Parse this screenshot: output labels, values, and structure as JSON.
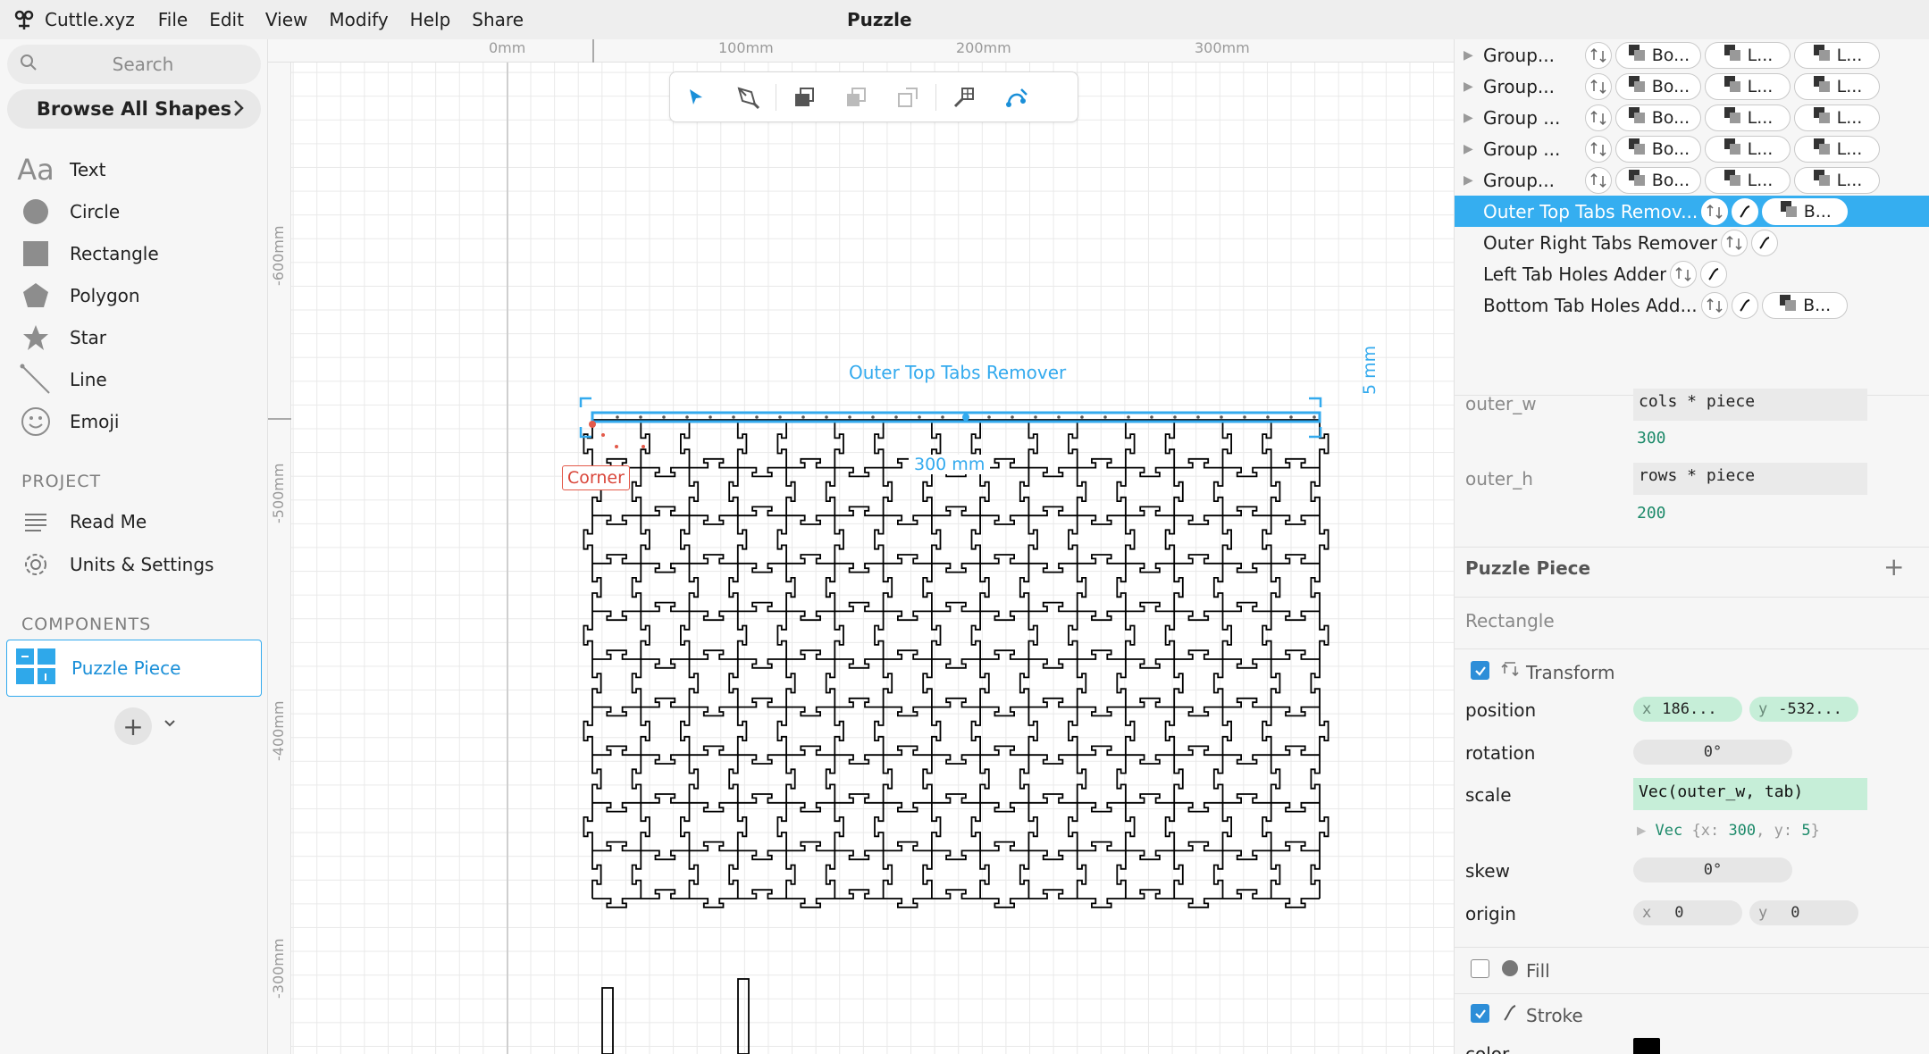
{
  "app": {
    "name": "Cuttle.xyz",
    "menu": [
      "File",
      "Edit",
      "View",
      "Modify",
      "Help",
      "Share"
    ],
    "document_title": "Puzzle"
  },
  "sidebar": {
    "search_placeholder": "Search",
    "browse_label": "Browse All Shapes",
    "shapes": [
      {
        "label": "Text",
        "icon": "text-icon"
      },
      {
        "label": "Circle",
        "icon": "circle-icon"
      },
      {
        "label": "Rectangle",
        "icon": "rectangle-icon"
      },
      {
        "label": "Polygon",
        "icon": "polygon-icon"
      },
      {
        "label": "Star",
        "icon": "star-icon"
      },
      {
        "label": "Line",
        "icon": "line-icon"
      },
      {
        "label": "Emoji",
        "icon": "emoji-icon"
      }
    ],
    "text_icon_glyph": "Aa",
    "project_heading": "PROJECT",
    "project_items": [
      {
        "label": "Read Me",
        "icon": "readme-icon"
      },
      {
        "label": "Units & Settings",
        "icon": "settings-icon"
      }
    ],
    "components_heading": "COMPONENTS",
    "components": [
      {
        "label": "Puzzle Piece",
        "icon": "puzzle-component-icon"
      }
    ],
    "add_component_glyph": "+"
  },
  "rulers": {
    "top": [
      "0mm",
      "100mm",
      "200mm",
      "300mm"
    ],
    "left": [
      "-600mm",
      "-500mm",
      "-400mm",
      "-300mm"
    ]
  },
  "toolbar": {
    "tools": [
      "select-arrow-icon",
      "pen-icon",
      "bring-forward-icon",
      "arrange-icon",
      "send-backward-icon",
      "link-grid-icon",
      "path-edit-icon"
    ]
  },
  "canvas": {
    "selection_label": "Outer Top Tabs Remover",
    "corner_label": "Corner",
    "width_dimension": "300 mm",
    "height_dimension": "5 mm",
    "puzzle_grid": {
      "cols": 15,
      "rows": 10
    },
    "colors": {
      "selection": "#33aaee",
      "corner": "#e35a4a",
      "puzzle_stroke": "#000000"
    }
  },
  "layers": [
    {
      "name": "Group...",
      "expandable": true,
      "pills": [
        "Bo...",
        "L...",
        "L..."
      ]
    },
    {
      "name": "Group...",
      "expandable": true,
      "pills": [
        "Bo...",
        "L...",
        "L..."
      ]
    },
    {
      "name": "Group ...",
      "expandable": true,
      "pills": [
        "Bo...",
        "L...",
        "L..."
      ]
    },
    {
      "name": "Group ...",
      "expandable": true,
      "pills": [
        "Bo...",
        "L...",
        "L..."
      ]
    },
    {
      "name": "Group...",
      "expandable": true,
      "pills": [
        "Bo...",
        "L...",
        "L..."
      ]
    },
    {
      "name": "Outer Top Tabs Remov...",
      "selected": true,
      "pills": [
        "B..."
      ]
    },
    {
      "name": "Outer Right Tabs Remover",
      "pills": []
    },
    {
      "name": "Left Tab Holes Adder",
      "pills": []
    },
    {
      "name": "Bottom Tab Holes Add...",
      "pills": [
        "B..."
      ]
    }
  ],
  "parameters": [
    {
      "name": "outer_w",
      "expression": "cols * piece",
      "value": "300"
    },
    {
      "name": "outer_h",
      "expression": "rows * piece",
      "value": "200"
    }
  ],
  "inspector": {
    "component_title": "Puzzle Piece",
    "add_glyph": "+",
    "shape_type": "Rectangle",
    "transform_label": "Transform",
    "position_label": "position",
    "position_x_axis": "x",
    "position_x": "186...",
    "position_y_axis": "y",
    "position_y": "-532...",
    "rotation_label": "rotation",
    "rotation": "0°",
    "scale_label": "scale",
    "scale_expression": "Vec(outer_w, tab)",
    "scale_result_key": "Vec",
    "scale_result_open": "{x:",
    "scale_result_x": "300",
    "scale_result_mid": ", y:",
    "scale_result_y": "5",
    "scale_result_close": "}",
    "skew_label": "skew",
    "skew": "0°",
    "origin_label": "origin",
    "origin_x_axis": "x",
    "origin_x": "0",
    "origin_y_axis": "y",
    "origin_y": "0",
    "fill_label": "Fill",
    "fill_enabled": false,
    "stroke_label": "Stroke",
    "stroke_enabled": true,
    "transform_enabled": true,
    "color_label": "color",
    "stroke_color": "#000000"
  }
}
